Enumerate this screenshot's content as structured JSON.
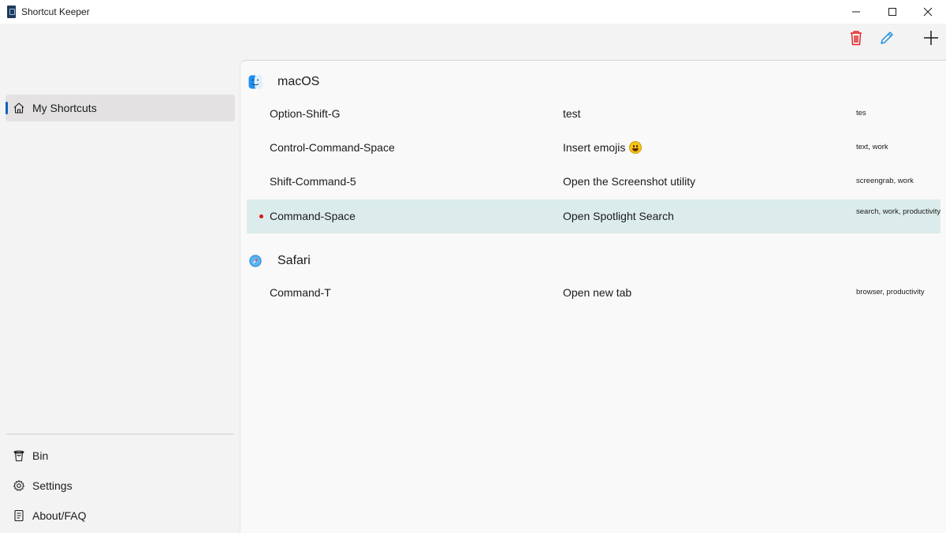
{
  "window": {
    "title": "Shortcut Keeper",
    "controls": [
      "minimize-icon",
      "maximize-icon",
      "close-icon"
    ]
  },
  "toolbar": {
    "icons": [
      "trash-icon",
      "pencil-icon",
      "plus-icon"
    ],
    "delete_color": "#e02020",
    "edit_color": "#1a8fd8"
  },
  "sidebar": {
    "items": [
      {
        "label": "My Shortcuts",
        "icon": "home-icon",
        "selected": true
      }
    ],
    "footer_items": [
      {
        "label": "Bin",
        "icon": "bin-icon"
      },
      {
        "label": "Settings",
        "icon": "gear-icon"
      },
      {
        "label": "About/FAQ",
        "icon": "document-icon"
      }
    ],
    "accent": "#0a62c0"
  },
  "groups": [
    {
      "name": "macOS",
      "icon": "finder-icon",
      "shortcuts": [
        {
          "keys": "Option-Shift-G",
          "description": "test",
          "tags": "tes"
        },
        {
          "keys": "Control-Command-Space",
          "description": "Insert emojis",
          "emoji": "grinning-face-emoji",
          "tags": "text, work"
        },
        {
          "keys": "Shift-Command-5",
          "description": "Open the Screenshot utility",
          "tags": "screengrab, work"
        },
        {
          "keys": "Command-Space",
          "description": "Open Spotlight Search",
          "tags": "search, work, productivity",
          "selected": true,
          "marker_color": "#d41a1a"
        }
      ]
    },
    {
      "name": "Safari",
      "icon": "safari-compass-icon",
      "shortcuts": [
        {
          "keys": "Command-T",
          "description": "Open new tab",
          "tags": "browser, productivity"
        }
      ]
    }
  ]
}
